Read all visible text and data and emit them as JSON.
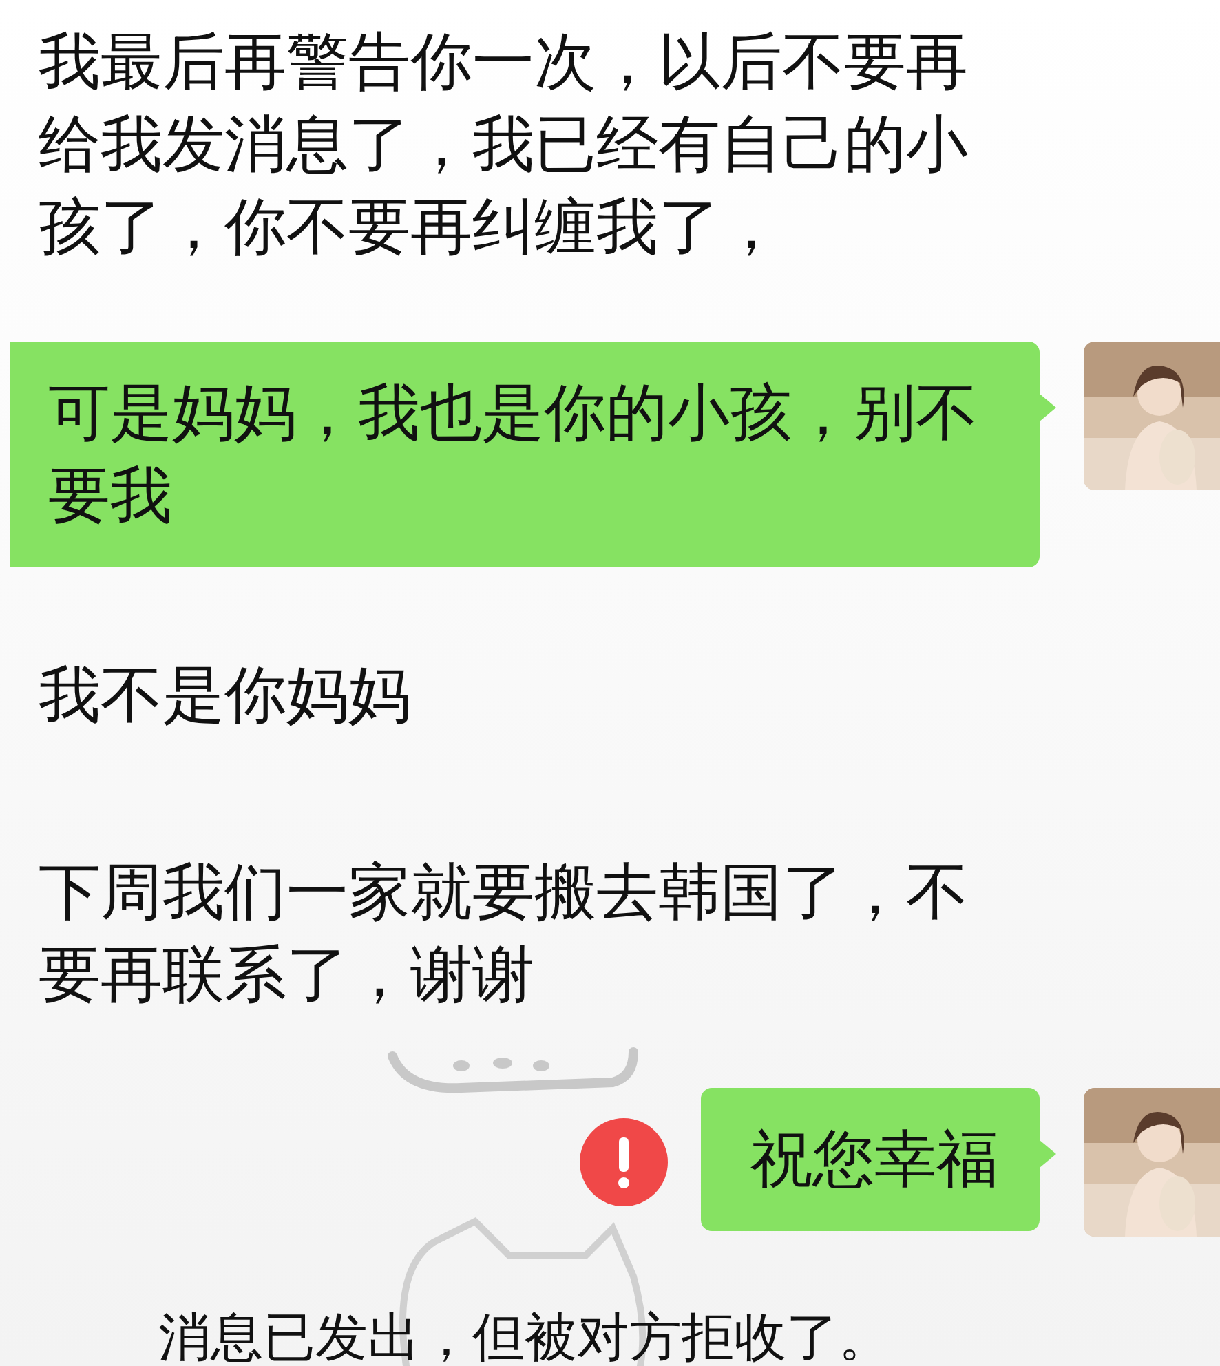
{
  "messages": [
    {
      "kind": "received",
      "text": "我最后再警告你一次，以后不要再给我发消息了，我已经有自己的小孩了，你不要再纠缠我了，"
    },
    {
      "kind": "sent",
      "text": "可是妈妈，我也是你的小孩，别不要我",
      "failed": false
    },
    {
      "kind": "received",
      "text": "我不是你妈妈"
    },
    {
      "kind": "received",
      "text": "下周我们一家就要搬去韩国了，不要再联系了，谢谢"
    },
    {
      "kind": "sent",
      "text": "祝您幸福",
      "failed": true
    }
  ],
  "notice": "消息已发出，但被对方拒收了。"
}
